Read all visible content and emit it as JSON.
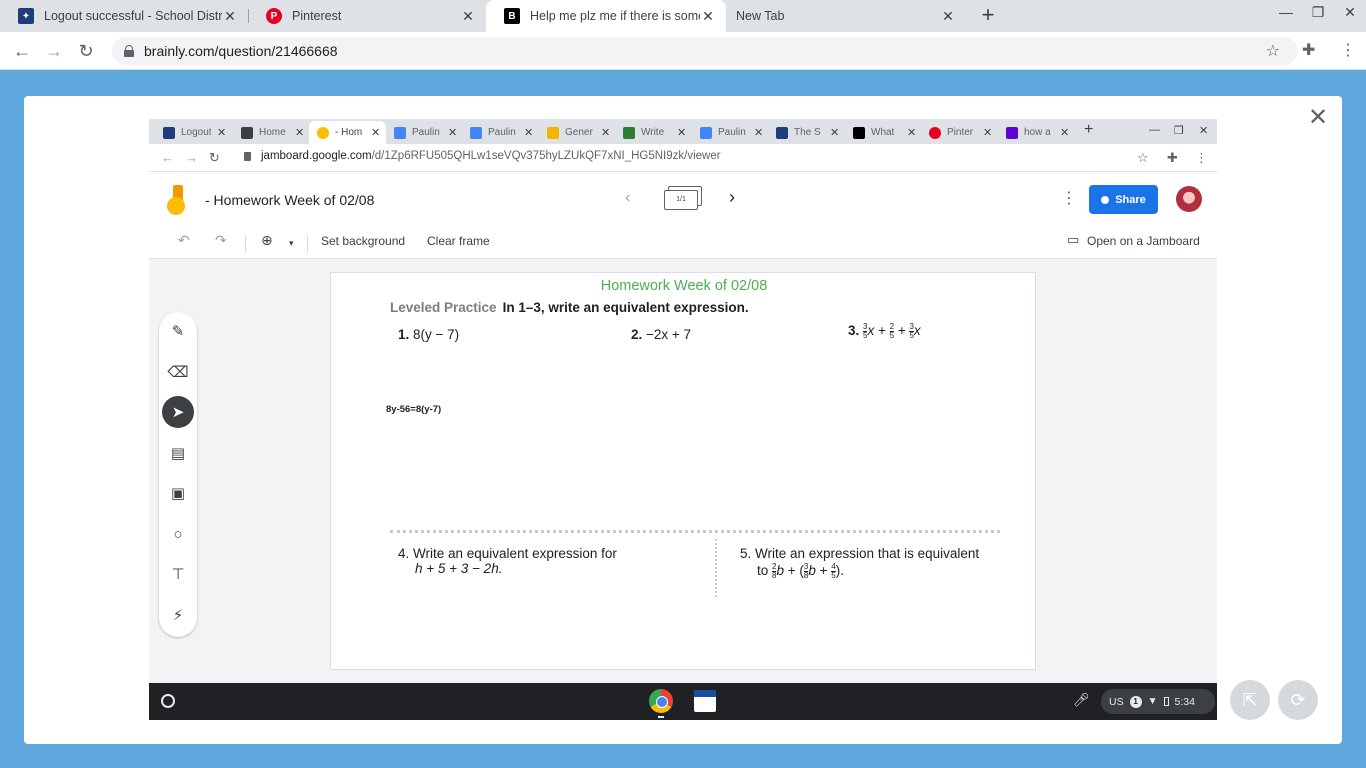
{
  "browser": {
    "tabs": [
      {
        "title": "Logout successful - School Distri"
      },
      {
        "title": "Pinterest"
      },
      {
        "title": "Help me plz me if there is some"
      },
      {
        "title": "New Tab"
      }
    ],
    "url": "brainly.com/question/21466668"
  },
  "inner_browser": {
    "tabs": [
      {
        "title": "Logout"
      },
      {
        "title": "Home"
      },
      {
        "title": "- Hom"
      },
      {
        "title": "Paulin"
      },
      {
        "title": "Paulin"
      },
      {
        "title": "Gener"
      },
      {
        "title": "Write"
      },
      {
        "title": "Paulin"
      },
      {
        "title": "The S"
      },
      {
        "title": "What"
      },
      {
        "title": "Pinter"
      },
      {
        "title": "how a"
      }
    ],
    "url_host": "jamboard.google.com",
    "url_path": "/d/1Zp6RFU505QHLw1seVQv375hyLZUkQF7xNI_HG5NI9zk/viewer"
  },
  "jamboard": {
    "title": "- Homework Week of 02/08",
    "frame_indicator": "1/1",
    "share_label": "Share",
    "toolbar": {
      "set_background": "Set background",
      "clear_frame": "Clear frame",
      "open_on_jamboard": "Open on a Jamboard"
    }
  },
  "worksheet": {
    "title": "Homework Week of 02/08",
    "leveled_practice": "Leveled Practice",
    "instruction": "In 1–3, write an equivalent expression.",
    "p1_num": "1.",
    "p1_text": "8(y − 7)",
    "p2_num": "2.",
    "p2_text": "−2x + 7",
    "p3_num": "3.",
    "p4_line1": "4. Write an equivalent expression for",
    "p4_line2": "h + 5 + 3 − 2h.",
    "p5_line1": "5. Write an expression that is equivalent",
    "p5_to": "to",
    "student_answer": "8y-56=8(y-7)"
  },
  "shelf": {
    "ime": "US",
    "notif_count": "1",
    "time": "5:34"
  },
  "colors": {
    "page_bg": "#5fa8de",
    "share_blue": "#1a73e8",
    "worksheet_title_green": "#4caf50"
  }
}
